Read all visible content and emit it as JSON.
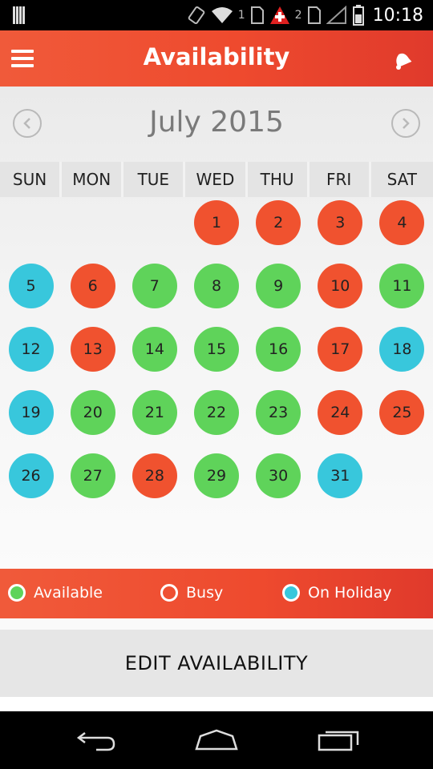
{
  "status_bar": {
    "sim1_label": "1",
    "sim2_label": "2",
    "time": "10:18",
    "icons": [
      "barcode-icon",
      "vibrate-icon",
      "wifi-icon",
      "sim-icon",
      "swiss-flag-icon",
      "signal-icon",
      "battery-icon"
    ]
  },
  "app_bar": {
    "title": "Availability",
    "menu_icon": "menu-icon",
    "bell_icon": "bell-icon"
  },
  "calendar": {
    "month_label": "July 2015",
    "prev_icon": "chevron-left-icon",
    "next_icon": "chevron-right-icon",
    "weekdays": [
      "SUN",
      "MON",
      "TUE",
      "WED",
      "THU",
      "FRI",
      "SAT"
    ],
    "first_weekday_index": 3,
    "days": [
      {
        "day": "1",
        "status": "busy"
      },
      {
        "day": "2",
        "status": "busy"
      },
      {
        "day": "3",
        "status": "busy"
      },
      {
        "day": "4",
        "status": "busy"
      },
      {
        "day": "5",
        "status": "holiday"
      },
      {
        "day": "6",
        "status": "busy"
      },
      {
        "day": "7",
        "status": "available"
      },
      {
        "day": "8",
        "status": "available"
      },
      {
        "day": "9",
        "status": "available"
      },
      {
        "day": "10",
        "status": "busy"
      },
      {
        "day": "11",
        "status": "available"
      },
      {
        "day": "12",
        "status": "holiday"
      },
      {
        "day": "13",
        "status": "busy"
      },
      {
        "day": "14",
        "status": "available"
      },
      {
        "day": "15",
        "status": "available"
      },
      {
        "day": "16",
        "status": "available"
      },
      {
        "day": "17",
        "status": "busy"
      },
      {
        "day": "18",
        "status": "holiday"
      },
      {
        "day": "19",
        "status": "holiday"
      },
      {
        "day": "20",
        "status": "available"
      },
      {
        "day": "21",
        "status": "available"
      },
      {
        "day": "22",
        "status": "available"
      },
      {
        "day": "23",
        "status": "available"
      },
      {
        "day": "24",
        "status": "busy"
      },
      {
        "day": "25",
        "status": "busy"
      },
      {
        "day": "26",
        "status": "holiday"
      },
      {
        "day": "27",
        "status": "available"
      },
      {
        "day": "28",
        "status": "busy"
      },
      {
        "day": "29",
        "status": "available"
      },
      {
        "day": "30",
        "status": "available"
      },
      {
        "day": "31",
        "status": "holiday"
      }
    ]
  },
  "legend": {
    "available_label": "Available",
    "busy_label": "Busy",
    "holiday_label": "On Holiday",
    "available_color": "#5fd35a",
    "busy_color": "#ffffff",
    "holiday_color": "#38c7dc"
  },
  "colors": {
    "accent": "#ee4a2e",
    "busy": "#f0522f",
    "available": "#5fd35a",
    "holiday": "#38c7dc"
  },
  "actions": {
    "edit_label": "EDIT AVAILABILITY"
  },
  "nav_bar": {
    "icons": [
      "back-icon",
      "home-icon",
      "recents-icon"
    ]
  }
}
